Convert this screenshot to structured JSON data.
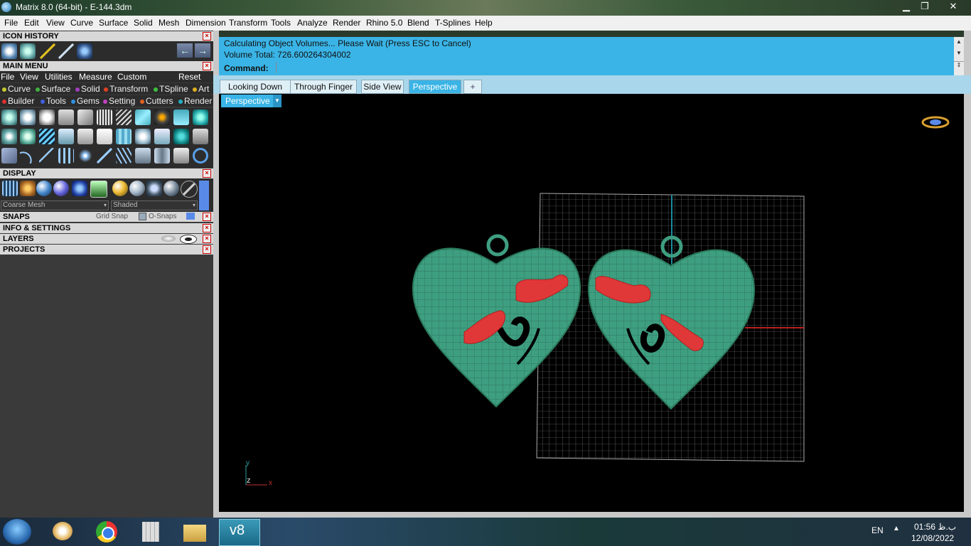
{
  "window": {
    "title": "Matrix 8.0 (64-bit) - E-144.3dm",
    "min": "▁",
    "max": "❐",
    "close": "✕"
  },
  "menubar": [
    "File",
    "Edit",
    "View",
    "Curve",
    "Surface",
    "Solid",
    "Mesh",
    "Dimension",
    "Transform",
    "Tools",
    "Analyze",
    "Render",
    "Rhino 5.0",
    "Blend",
    "T-Splines",
    "Help"
  ],
  "panel": {
    "icon_history": "ICON HISTORY",
    "main_menu": "MAIN MENU",
    "main_menu_items": [
      "File",
      "View",
      "Utilities",
      "Measure",
      "Custom"
    ],
    "reset": "Reset",
    "categories_row1": [
      {
        "label": "Curve",
        "color": "#c8c830"
      },
      {
        "label": "Surface",
        "color": "#40b040"
      },
      {
        "label": "Solid",
        "color": "#a040c0"
      },
      {
        "label": "Transform",
        "color": "#e04020"
      },
      {
        "label": "TSpline",
        "color": "#40c040"
      },
      {
        "label": "Art",
        "color": "#e0b020"
      }
    ],
    "categories_row2": [
      {
        "label": "Builder",
        "color": "#e03030"
      },
      {
        "label": "Tools",
        "color": "#4060e0"
      },
      {
        "label": "Gems",
        "color": "#3090e0"
      },
      {
        "label": "Setting",
        "color": "#c040c0"
      },
      {
        "label": "Cutters",
        "color": "#e06020"
      },
      {
        "label": "Render",
        "color": "#20b0c0"
      }
    ],
    "display": "DISPLAY",
    "mesh_quality": "Coarse Mesh",
    "shading": "Shaded",
    "snaps": "SNAPS",
    "grid_snap": "Grid Snap",
    "osnaps": "O-Snaps",
    "info_settings": "INFO & SETTINGS",
    "layers": "LAYERS",
    "projects": "PROJECTS"
  },
  "command": {
    "line1": "Calculating Object Volumes... Please Wait (Press ESC to Cancel)",
    "line2": "Volume Total: 726.600264304002",
    "label": "Command:",
    "value": ""
  },
  "tabs": [
    "Looking Down",
    "Through Finger",
    "Side View",
    "Perspective"
  ],
  "add_tab": "+",
  "viewport": {
    "name": "Perspective",
    "axis_y": "y",
    "axis_z": "z",
    "axis_x": "x"
  },
  "tray": {
    "lang": "EN",
    "time": "01:56 ب.ظ",
    "date": "12/08/2022"
  },
  "colors": {
    "accent": "#3ab4e6",
    "heart": "#3e9e80",
    "bird": "#e03838"
  }
}
